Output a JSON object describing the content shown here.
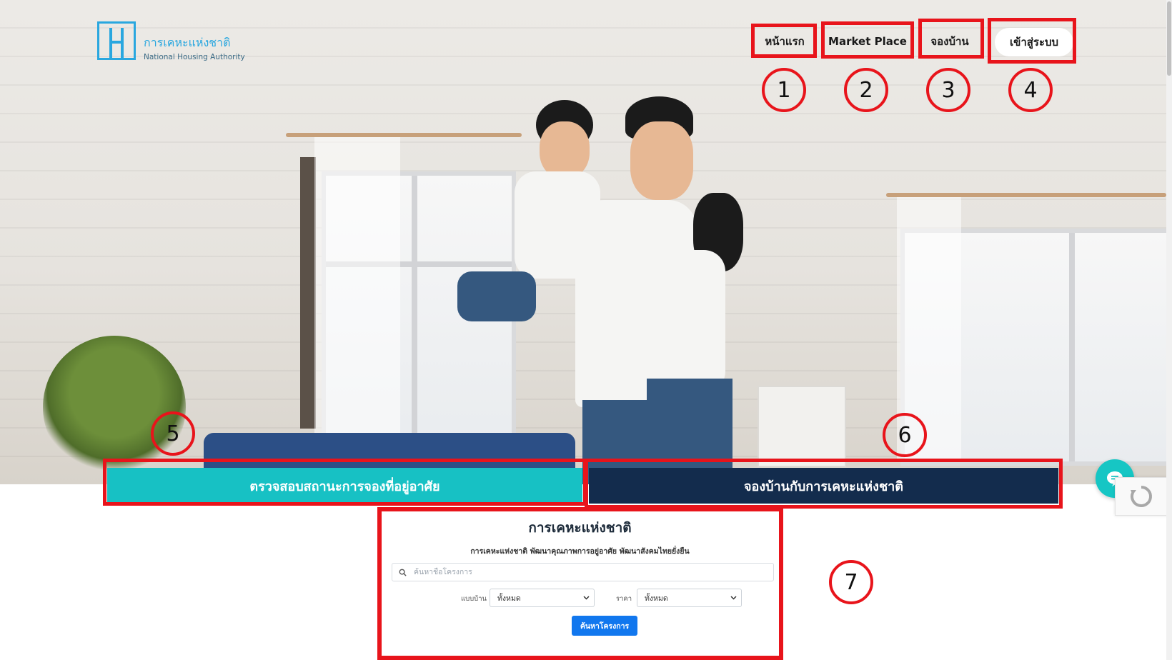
{
  "logo": {
    "name_th": "การเคหะแห่งชาติ",
    "name_en": "National Housing Authority",
    "color": "#29a7df"
  },
  "nav": {
    "items": [
      {
        "label": "หน้าแรก"
      },
      {
        "label": "Market Place"
      },
      {
        "label": "จองบ้าน"
      }
    ],
    "login_label": "เข้าสู่ระบบ"
  },
  "annotations": {
    "markers": [
      "1",
      "2",
      "3",
      "4",
      "5",
      "6",
      "7"
    ],
    "color": "#e8141b"
  },
  "cta": {
    "status_label": "ตรวจสอบสถานะการจองที่อยู่อาศัย",
    "status_color": "#17c1c4",
    "book_label": "จองบ้านกับการเคหะแห่งชาติ",
    "book_color": "#132c4d"
  },
  "search": {
    "title": "การเคหะแห่งชาติ",
    "subtitle": "การเคหะแห่งชาติ พัฒนาคุณภาพการอยู่อาศัย พัฒนาสังคมไทยยั่งยืน",
    "placeholder": "ค้นหาชื่อโครงการ",
    "house_type_label": "แบบบ้าน",
    "house_type_value": "ทั้งหมด",
    "price_label": "ราคา",
    "price_value": "ทั้งหมด",
    "button_label": "ค้นหาโครงการ",
    "button_color": "#1177ee"
  },
  "widgets": {
    "chat_icon": "chat-bubble-icon",
    "recaptcha_icon": "recaptcha-icon"
  }
}
